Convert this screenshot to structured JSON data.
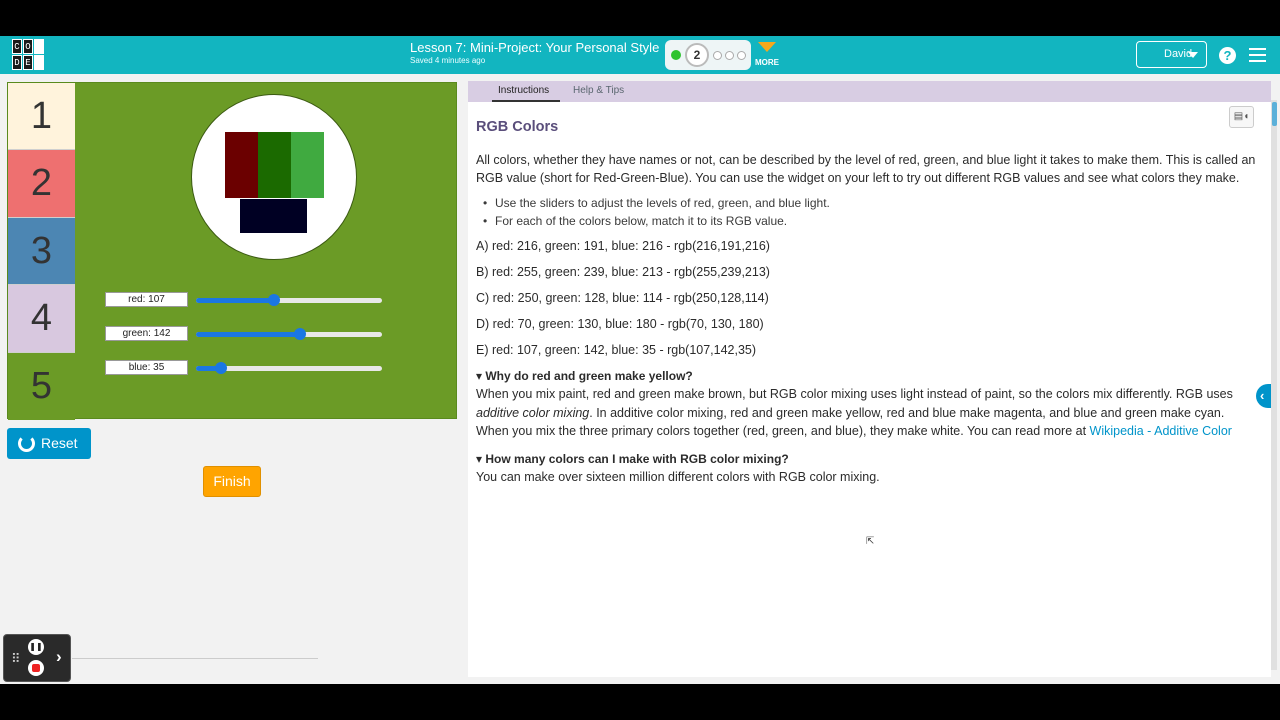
{
  "header": {
    "logo_letters": [
      "C",
      "O",
      "",
      "D",
      "E",
      ""
    ],
    "lesson_title": "Lesson 7: Mini-Project: Your Personal Style",
    "saved_text": "Saved 4 minutes ago",
    "current_level": "2",
    "more_label": "MORE",
    "user_name": "David",
    "help_glyph": "?"
  },
  "widget": {
    "numbers": [
      "1",
      "2",
      "3",
      "4",
      "5"
    ],
    "box_colors": [
      "#fff3dc",
      "#ee7070",
      "#4c86b3",
      "#d8c8df",
      "#6b9b26"
    ],
    "sliders": [
      {
        "label": "red: 107",
        "fraction": 0.42
      },
      {
        "label": "green: 142",
        "fraction": 0.557
      },
      {
        "label": "blue: 35",
        "fraction": 0.137
      }
    ],
    "reset_label": "Reset",
    "finish_label": "Finish"
  },
  "instructions": {
    "tab_instructions": "Instructions",
    "tab_help": "Help & Tips",
    "title": "RGB Colors",
    "intro": "All colors, whether they have names or not, can be described by the level of red, green, and blue light it takes to make them. This is called an RGB value (short for Red-Green-Blue). You can use the widget on your left to try out different RGB values and see what colors they make.",
    "bullets": [
      "Use the sliders to adjust the levels of red, green, and blue light.",
      "For each of the colors below, match it to its RGB value."
    ],
    "rgb_lines": [
      "A) red: 216, green: 191, blue: 216 - rgb(216,191,216)",
      "B) red: 255, green: 239, blue: 213 - rgb(255,239,213)",
      "C) red: 250, green: 128, blue: 114 - rgb(250,128,114)",
      "D) red: 70, green: 130, blue: 180 - rgb(70, 130, 180)",
      "E) red: 107, green: 142, blue: 35 - rgb(107,142,35)"
    ],
    "q1_title": "Why do red and green make yellow?",
    "q1_text_a": "When you mix paint, red and green make brown, but RGB color mixing uses light instead of paint, so the colors mix differently. RGB uses ",
    "q1_text_em": "additive color mixing",
    "q1_text_b": ". In additive color mixing, red and green make yellow, red and blue make magenta, and blue and green make cyan. When you mix the three primary colors together (red, green, and blue), they make white. You can read more at ",
    "q1_link": "Wikipedia - Additive Color",
    "q2_title": "How many colors can I make with RGB color mixing?",
    "q2_text": "You can make over sixteen million different colors with RGB color mixing."
  },
  "icons": {
    "reset": "refresh-icon",
    "tts": "text-to-speech-icon",
    "collapse": "chevron-left-icon",
    "help": "help-icon",
    "menu": "hamburger-menu-icon"
  }
}
